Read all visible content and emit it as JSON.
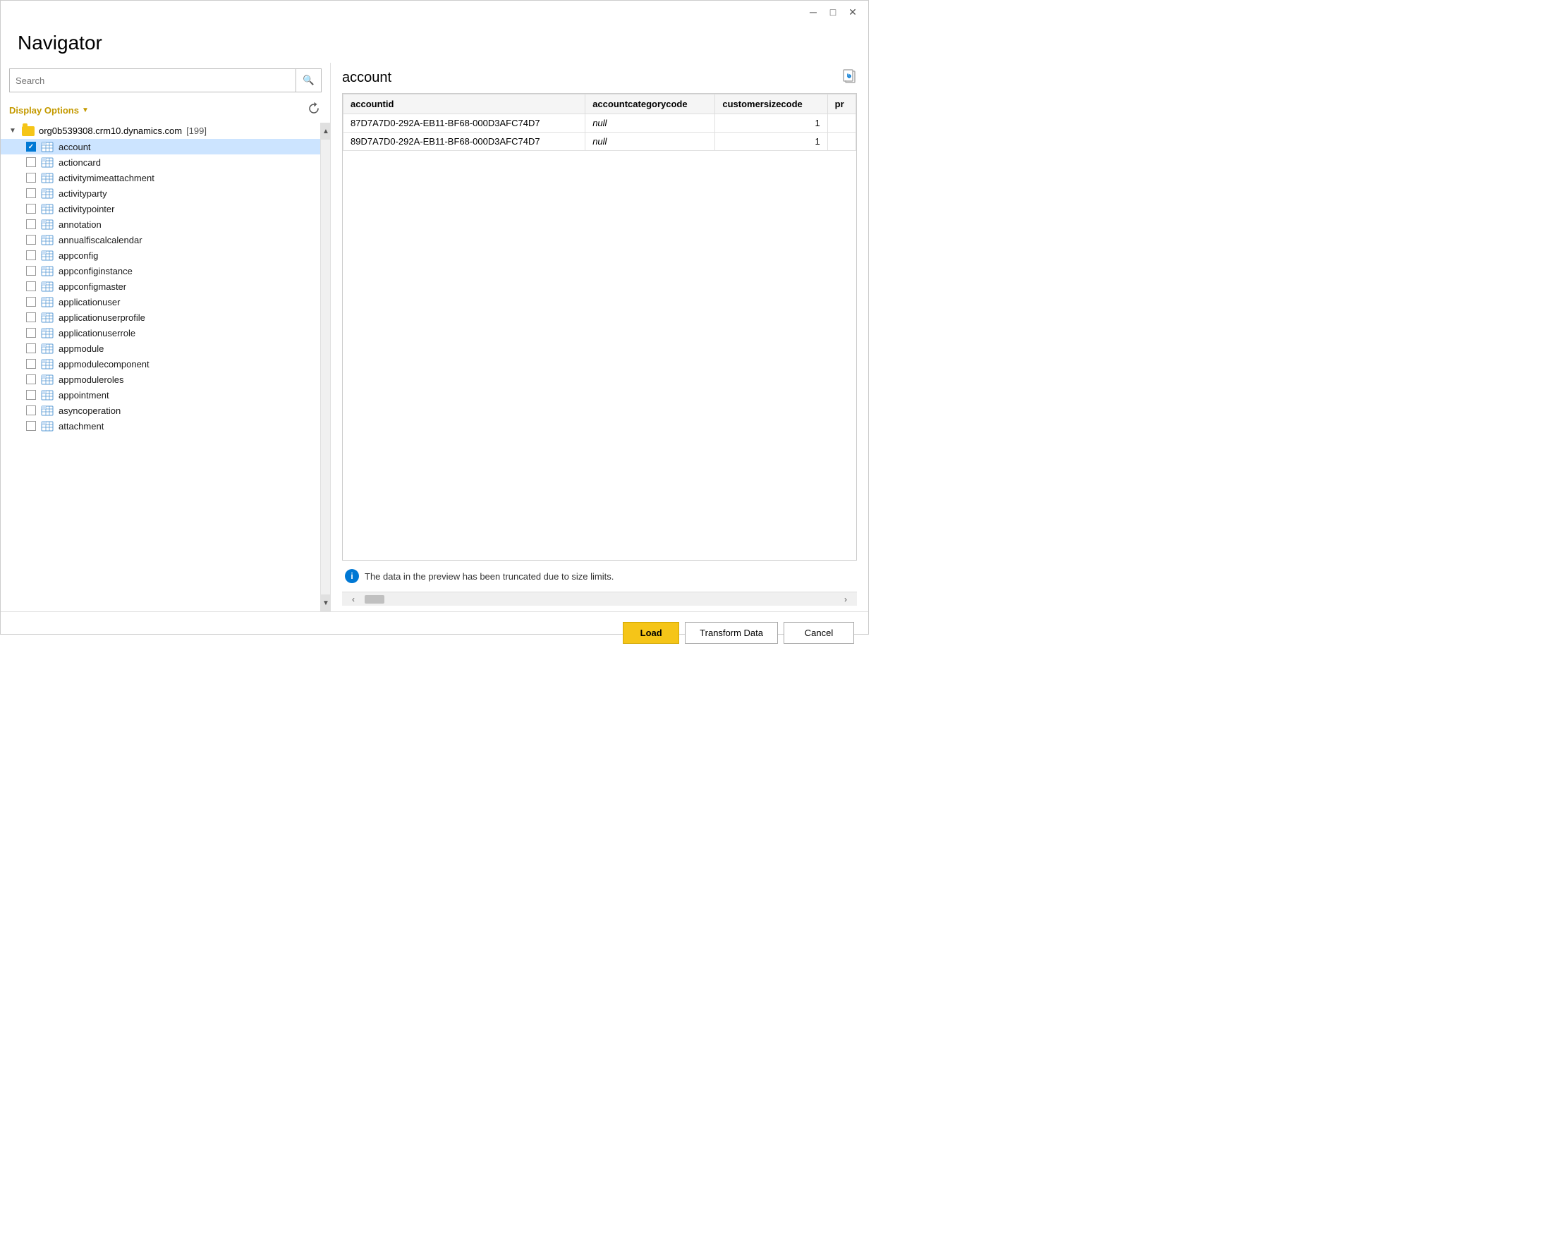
{
  "window": {
    "title": "Navigator",
    "minimize_label": "─",
    "restore_label": "□",
    "close_label": "✕"
  },
  "header": {
    "title": "Navigator"
  },
  "left_panel": {
    "search_placeholder": "Search",
    "display_options_label": "Display Options",
    "display_options_chevron": "▼",
    "root_node": {
      "label": "org0b539308.crm10.dynamics.com",
      "count": "[199]"
    },
    "items": [
      {
        "id": "account",
        "label": "account",
        "checked": true
      },
      {
        "id": "actioncard",
        "label": "actioncard",
        "checked": false
      },
      {
        "id": "activitymimeattachment",
        "label": "activitymimeattachment",
        "checked": false
      },
      {
        "id": "activityparty",
        "label": "activityparty",
        "checked": false
      },
      {
        "id": "activitypointer",
        "label": "activitypointer",
        "checked": false
      },
      {
        "id": "annotation",
        "label": "annotation",
        "checked": false
      },
      {
        "id": "annualfiscalcalendar",
        "label": "annualfiscalcalendar",
        "checked": false
      },
      {
        "id": "appconfig",
        "label": "appconfig",
        "checked": false
      },
      {
        "id": "appconfiginstance",
        "label": "appconfiginstance",
        "checked": false
      },
      {
        "id": "appconfigmaster",
        "label": "appconfigmaster",
        "checked": false
      },
      {
        "id": "applicationuser",
        "label": "applicationuser",
        "checked": false
      },
      {
        "id": "applicationuserprofile",
        "label": "applicationuserprofile",
        "checked": false
      },
      {
        "id": "applicationuserrole",
        "label": "applicationuserrole",
        "checked": false
      },
      {
        "id": "appmodule",
        "label": "appmodule",
        "checked": false
      },
      {
        "id": "appmodulecomponent",
        "label": "appmodulecomponent",
        "checked": false
      },
      {
        "id": "appmoduleroles",
        "label": "appmoduleroles",
        "checked": false
      },
      {
        "id": "appointment",
        "label": "appointment",
        "checked": false
      },
      {
        "id": "asyncoperation",
        "label": "asyncoperation",
        "checked": false
      },
      {
        "id": "attachment",
        "label": "attachment",
        "checked": false
      }
    ]
  },
  "right_panel": {
    "preview_title": "account",
    "truncate_notice": "The data in the preview has been truncated due to size limits.",
    "table": {
      "columns": [
        "accountid",
        "accountcategorycode",
        "customersizecode",
        "pr"
      ],
      "rows": [
        {
          "accountid": "87D7A7D0-292A-EB11-BF68-000D3AFC74D7",
          "accountcategorycode": "null",
          "customersizecode": "1",
          "pr": ""
        },
        {
          "accountid": "89D7A7D0-292A-EB11-BF68-000D3AFC74D7",
          "accountcategorycode": "null",
          "customersizecode": "1",
          "pr": ""
        }
      ]
    }
  },
  "bottom_bar": {
    "load_label": "Load",
    "transform_data_label": "Transform Data",
    "cancel_label": "Cancel"
  }
}
